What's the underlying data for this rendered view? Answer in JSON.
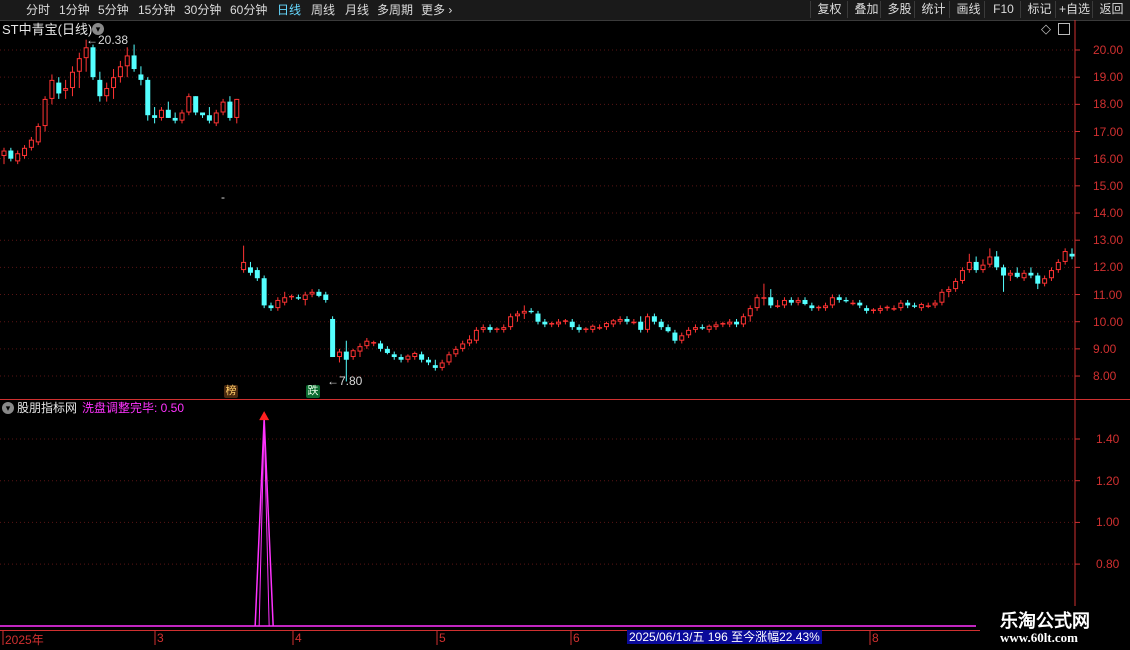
{
  "toolbar": {
    "periods": [
      "分时",
      "1分钟",
      "5分钟",
      "15分钟",
      "30分钟",
      "60分钟",
      "日线",
      "周线",
      "月线",
      "多周期",
      "更多"
    ],
    "active_period": "日线",
    "more_arrow": "›",
    "right_buttons": [
      "复权",
      "叠加",
      "多股",
      "统计",
      "画线",
      "F10",
      "标记",
      "+自选",
      "返回"
    ]
  },
  "stock": {
    "title": "ST中青宝(日线)",
    "icon": "chevron-down-icon"
  },
  "price_axis": [
    "20.00",
    "19.00",
    "18.00",
    "17.00",
    "16.00",
    "15.00",
    "14.00",
    "13.00",
    "12.00",
    "11.00",
    "10.00",
    "9.00",
    "8.00"
  ],
  "annotations": {
    "high_label": "20.38",
    "low_label": "7.80",
    "badge_bang": "榜",
    "badge_die": "跌",
    "dash": "-"
  },
  "indicator": {
    "name": "股朋指标网",
    "formula": "洗盘调整完毕: 0.50",
    "axis": [
      "1.40",
      "1.20",
      "1.00",
      "0.80"
    ],
    "color": "#ff33ff"
  },
  "date_axis": [
    "2025年",
    "3",
    "4",
    "5",
    "6",
    "8"
  ],
  "cursor_info": "2025/06/13/五 196 至今涨幅22.43%",
  "watermark": {
    "line1": "乐淘公式网",
    "line2": "www.60lt.com"
  },
  "colors": {
    "up": "#ff3333",
    "down": "#54ffff",
    "axis": "#d03030",
    "grid": "#5a1414"
  },
  "chart_data": {
    "type": "candlestick",
    "title": "ST中青宝(日线)",
    "ylim": [
      7.5,
      20.6
    ],
    "x_labels": [
      "2025年",
      "3",
      "4",
      "5",
      "6",
      "8"
    ],
    "candles": [
      [
        16.1,
        16.4,
        15.8,
        16.3
      ],
      [
        16.3,
        16.4,
        15.9,
        16.0
      ],
      [
        15.9,
        16.3,
        15.8,
        16.2
      ],
      [
        16.1,
        16.5,
        16.0,
        16.4
      ],
      [
        16.4,
        16.8,
        16.3,
        16.7
      ],
      [
        16.6,
        17.3,
        16.5,
        17.2
      ],
      [
        17.2,
        18.3,
        17.0,
        18.2
      ],
      [
        18.2,
        19.1,
        18.0,
        18.9
      ],
      [
        18.8,
        19.0,
        18.2,
        18.4
      ],
      [
        18.5,
        18.9,
        18.2,
        18.6
      ],
      [
        18.6,
        19.4,
        18.3,
        19.2
      ],
      [
        19.2,
        19.9,
        18.6,
        19.7
      ],
      [
        19.7,
        20.38,
        19.2,
        20.1
      ],
      [
        20.1,
        20.2,
        18.9,
        19.0
      ],
      [
        18.9,
        19.2,
        18.1,
        18.3
      ],
      [
        18.3,
        18.8,
        18.1,
        18.6
      ],
      [
        18.6,
        19.3,
        18.2,
        19.0
      ],
      [
        19.0,
        19.6,
        18.8,
        19.4
      ],
      [
        19.4,
        20.1,
        19.0,
        19.8
      ],
      [
        19.8,
        20.2,
        19.2,
        19.3
      ],
      [
        19.1,
        19.4,
        18.7,
        18.9
      ],
      [
        18.9,
        19.0,
        17.4,
        17.6
      ],
      [
        17.6,
        17.9,
        17.3,
        17.5
      ],
      [
        17.5,
        17.9,
        17.4,
        17.8
      ],
      [
        17.8,
        18.1,
        17.5,
        17.5
      ],
      [
        17.5,
        17.7,
        17.3,
        17.4
      ],
      [
        17.4,
        17.8,
        17.3,
        17.7
      ],
      [
        17.7,
        18.4,
        17.6,
        18.3
      ],
      [
        18.3,
        18.3,
        17.6,
        17.7
      ],
      [
        17.7,
        17.7,
        17.5,
        17.6
      ],
      [
        17.6,
        17.9,
        17.3,
        17.4
      ],
      [
        17.3,
        17.8,
        17.2,
        17.7
      ],
      [
        17.7,
        18.2,
        17.6,
        18.1
      ],
      [
        18.1,
        18.3,
        17.4,
        17.5
      ],
      [
        17.5,
        18.2,
        17.3,
        18.2
      ],
      [
        11.9,
        12.8,
        11.8,
        12.2
      ],
      [
        12.0,
        12.2,
        11.7,
        11.8
      ],
      [
        11.9,
        12.0,
        11.5,
        11.6
      ],
      [
        11.6,
        11.7,
        10.5,
        10.6
      ],
      [
        10.6,
        10.7,
        10.4,
        10.5
      ],
      [
        10.5,
        10.9,
        10.4,
        10.8
      ],
      [
        10.7,
        11.1,
        10.6,
        10.9
      ],
      [
        10.9,
        11.0,
        10.8,
        10.95
      ],
      [
        10.9,
        11.0,
        10.8,
        10.85
      ],
      [
        10.8,
        11.1,
        10.6,
        11.0
      ],
      [
        11.0,
        11.2,
        10.9,
        11.1
      ],
      [
        11.1,
        11.2,
        10.9,
        10.95
      ],
      [
        11.0,
        11.1,
        10.7,
        10.8
      ],
      [
        10.1,
        10.2,
        8.7,
        8.7
      ],
      [
        8.7,
        9.0,
        8.5,
        8.9
      ],
      [
        8.9,
        9.3,
        7.8,
        8.6
      ],
      [
        8.7,
        9.0,
        8.6,
        8.95
      ],
      [
        8.9,
        9.2,
        8.7,
        9.1
      ],
      [
        9.1,
        9.4,
        9.0,
        9.3
      ],
      [
        9.2,
        9.3,
        9.1,
        9.25
      ],
      [
        9.2,
        9.3,
        8.9,
        9.0
      ],
      [
        9.0,
        9.1,
        8.8,
        8.85
      ],
      [
        8.8,
        8.9,
        8.6,
        8.7
      ],
      [
        8.7,
        8.8,
        8.5,
        8.6
      ],
      [
        8.6,
        8.8,
        8.5,
        8.75
      ],
      [
        8.7,
        8.9,
        8.6,
        8.85
      ],
      [
        8.8,
        8.9,
        8.5,
        8.6
      ],
      [
        8.6,
        8.7,
        8.4,
        8.5
      ],
      [
        8.4,
        8.6,
        8.2,
        8.3
      ],
      [
        8.3,
        8.6,
        8.2,
        8.5
      ],
      [
        8.5,
        8.9,
        8.4,
        8.8
      ],
      [
        8.8,
        9.1,
        8.7,
        9.0
      ],
      [
        9.0,
        9.3,
        8.9,
        9.2
      ],
      [
        9.2,
        9.5,
        9.1,
        9.35
      ],
      [
        9.3,
        9.8,
        9.2,
        9.7
      ],
      [
        9.7,
        9.9,
        9.6,
        9.8
      ],
      [
        9.8,
        9.9,
        9.6,
        9.7
      ],
      [
        9.7,
        9.8,
        9.6,
        9.75
      ],
      [
        9.7,
        9.9,
        9.6,
        9.8
      ],
      [
        9.8,
        10.3,
        9.7,
        10.2
      ],
      [
        10.2,
        10.4,
        10.0,
        10.3
      ],
      [
        10.3,
        10.6,
        10.1,
        10.4
      ],
      [
        10.4,
        10.5,
        10.3,
        10.35
      ],
      [
        10.3,
        10.4,
        9.9,
        10.0
      ],
      [
        10.0,
        10.1,
        9.8,
        9.9
      ],
      [
        9.9,
        10.0,
        9.8,
        9.95
      ],
      [
        9.9,
        10.1,
        9.8,
        10.0
      ],
      [
        10.0,
        10.1,
        9.9,
        10.05
      ],
      [
        10.0,
        10.1,
        9.7,
        9.8
      ],
      [
        9.8,
        9.9,
        9.6,
        9.7
      ],
      [
        9.7,
        9.8,
        9.6,
        9.75
      ],
      [
        9.7,
        9.9,
        9.6,
        9.85
      ],
      [
        9.8,
        9.9,
        9.7,
        9.8
      ],
      [
        9.8,
        10.0,
        9.7,
        9.95
      ],
      [
        9.9,
        10.1,
        9.8,
        10.05
      ],
      [
        10.0,
        10.2,
        9.9,
        10.1
      ],
      [
        10.1,
        10.2,
        9.9,
        10.0
      ],
      [
        10.0,
        10.1,
        9.9,
        10.0
      ],
      [
        10.0,
        10.2,
        9.6,
        9.7
      ],
      [
        9.7,
        10.3,
        9.6,
        10.2
      ],
      [
        10.2,
        10.3,
        9.9,
        10.0
      ],
      [
        10.0,
        10.1,
        9.7,
        9.8
      ],
      [
        9.8,
        9.9,
        9.6,
        9.65
      ],
      [
        9.6,
        9.7,
        9.2,
        9.3
      ],
      [
        9.3,
        9.6,
        9.2,
        9.5
      ],
      [
        9.5,
        9.8,
        9.4,
        9.7
      ],
      [
        9.7,
        9.9,
        9.6,
        9.8
      ],
      [
        9.8,
        9.9,
        9.7,
        9.75
      ],
      [
        9.7,
        9.9,
        9.6,
        9.85
      ],
      [
        9.8,
        10.0,
        9.7,
        9.9
      ],
      [
        9.9,
        10.0,
        9.8,
        9.95
      ],
      [
        9.9,
        10.1,
        9.8,
        10.0
      ],
      [
        10.0,
        10.1,
        9.8,
        9.9
      ],
      [
        9.9,
        10.3,
        9.8,
        10.2
      ],
      [
        10.2,
        10.6,
        10.0,
        10.5
      ],
      [
        10.5,
        11.0,
        10.4,
        10.9
      ],
      [
        10.9,
        11.4,
        10.6,
        10.9
      ],
      [
        10.9,
        11.2,
        10.5,
        10.6
      ],
      [
        10.6,
        10.8,
        10.5,
        10.6
      ],
      [
        10.6,
        10.9,
        10.5,
        10.8
      ],
      [
        10.8,
        10.9,
        10.6,
        10.7
      ],
      [
        10.7,
        10.9,
        10.6,
        10.8
      ],
      [
        10.8,
        10.9,
        10.6,
        10.65
      ],
      [
        10.6,
        10.7,
        10.4,
        10.5
      ],
      [
        10.5,
        10.6,
        10.4,
        10.55
      ],
      [
        10.5,
        10.7,
        10.4,
        10.6
      ],
      [
        10.6,
        11.0,
        10.5,
        10.9
      ],
      [
        10.9,
        11.0,
        10.7,
        10.8
      ],
      [
        10.8,
        10.9,
        10.7,
        10.75
      ],
      [
        10.7,
        10.8,
        10.6,
        10.7
      ],
      [
        10.7,
        10.8,
        10.5,
        10.6
      ],
      [
        10.5,
        10.6,
        10.3,
        10.4
      ],
      [
        10.4,
        10.5,
        10.3,
        10.45
      ],
      [
        10.4,
        10.6,
        10.3,
        10.5
      ],
      [
        10.5,
        10.6,
        10.4,
        10.55
      ],
      [
        10.5,
        10.6,
        10.4,
        10.5
      ],
      [
        10.5,
        10.8,
        10.4,
        10.7
      ],
      [
        10.7,
        10.8,
        10.5,
        10.6
      ],
      [
        10.6,
        10.7,
        10.5,
        10.55
      ],
      [
        10.5,
        10.7,
        10.4,
        10.65
      ],
      [
        10.6,
        10.7,
        10.5,
        10.6
      ],
      [
        10.6,
        10.8,
        10.5,
        10.7
      ],
      [
        10.7,
        11.2,
        10.6,
        11.1
      ],
      [
        11.1,
        11.3,
        10.9,
        11.2
      ],
      [
        11.2,
        11.6,
        11.1,
        11.5
      ],
      [
        11.5,
        12.0,
        11.4,
        11.9
      ],
      [
        11.9,
        12.5,
        11.8,
        12.2
      ],
      [
        12.2,
        12.4,
        11.8,
        11.9
      ],
      [
        11.9,
        12.3,
        11.8,
        12.1
      ],
      [
        12.1,
        12.7,
        12.0,
        12.4
      ],
      [
        12.4,
        12.6,
        11.9,
        12.0
      ],
      [
        12.0,
        12.1,
        11.1,
        11.7
      ],
      [
        11.7,
        11.9,
        11.5,
        11.8
      ],
      [
        11.8,
        12.0,
        11.6,
        11.65
      ],
      [
        11.6,
        11.9,
        11.5,
        11.8
      ],
      [
        11.8,
        12.0,
        11.6,
        11.7
      ],
      [
        11.7,
        11.8,
        11.2,
        11.4
      ],
      [
        11.4,
        11.7,
        11.3,
        11.6
      ],
      [
        11.6,
        12.0,
        11.5,
        11.9
      ],
      [
        11.9,
        12.3,
        11.8,
        12.2
      ],
      [
        12.2,
        12.7,
        12.1,
        12.6
      ],
      [
        12.5,
        12.7,
        12.3,
        12.4
      ]
    ],
    "indicator_series": {
      "name": "洗盘调整完毕",
      "spike_index": 38,
      "spike_value": 1.5,
      "ylim": [
        0.6,
        1.6
      ]
    }
  }
}
